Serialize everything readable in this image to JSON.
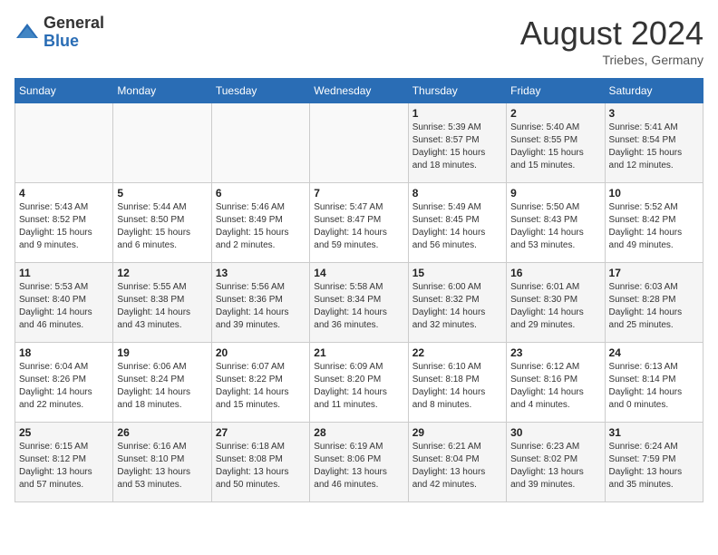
{
  "header": {
    "logo_general": "General",
    "logo_blue": "Blue",
    "month_title": "August 2024",
    "location": "Triebes, Germany"
  },
  "weekdays": [
    "Sunday",
    "Monday",
    "Tuesday",
    "Wednesday",
    "Thursday",
    "Friday",
    "Saturday"
  ],
  "weeks": [
    [
      {
        "day": "",
        "info": ""
      },
      {
        "day": "",
        "info": ""
      },
      {
        "day": "",
        "info": ""
      },
      {
        "day": "",
        "info": ""
      },
      {
        "day": "1",
        "info": "Sunrise: 5:39 AM\nSunset: 8:57 PM\nDaylight: 15 hours\nand 18 minutes."
      },
      {
        "day": "2",
        "info": "Sunrise: 5:40 AM\nSunset: 8:55 PM\nDaylight: 15 hours\nand 15 minutes."
      },
      {
        "day": "3",
        "info": "Sunrise: 5:41 AM\nSunset: 8:54 PM\nDaylight: 15 hours\nand 12 minutes."
      }
    ],
    [
      {
        "day": "4",
        "info": "Sunrise: 5:43 AM\nSunset: 8:52 PM\nDaylight: 15 hours\nand 9 minutes."
      },
      {
        "day": "5",
        "info": "Sunrise: 5:44 AM\nSunset: 8:50 PM\nDaylight: 15 hours\nand 6 minutes."
      },
      {
        "day": "6",
        "info": "Sunrise: 5:46 AM\nSunset: 8:49 PM\nDaylight: 15 hours\nand 2 minutes."
      },
      {
        "day": "7",
        "info": "Sunrise: 5:47 AM\nSunset: 8:47 PM\nDaylight: 14 hours\nand 59 minutes."
      },
      {
        "day": "8",
        "info": "Sunrise: 5:49 AM\nSunset: 8:45 PM\nDaylight: 14 hours\nand 56 minutes."
      },
      {
        "day": "9",
        "info": "Sunrise: 5:50 AM\nSunset: 8:43 PM\nDaylight: 14 hours\nand 53 minutes."
      },
      {
        "day": "10",
        "info": "Sunrise: 5:52 AM\nSunset: 8:42 PM\nDaylight: 14 hours\nand 49 minutes."
      }
    ],
    [
      {
        "day": "11",
        "info": "Sunrise: 5:53 AM\nSunset: 8:40 PM\nDaylight: 14 hours\nand 46 minutes."
      },
      {
        "day": "12",
        "info": "Sunrise: 5:55 AM\nSunset: 8:38 PM\nDaylight: 14 hours\nand 43 minutes."
      },
      {
        "day": "13",
        "info": "Sunrise: 5:56 AM\nSunset: 8:36 PM\nDaylight: 14 hours\nand 39 minutes."
      },
      {
        "day": "14",
        "info": "Sunrise: 5:58 AM\nSunset: 8:34 PM\nDaylight: 14 hours\nand 36 minutes."
      },
      {
        "day": "15",
        "info": "Sunrise: 6:00 AM\nSunset: 8:32 PM\nDaylight: 14 hours\nand 32 minutes."
      },
      {
        "day": "16",
        "info": "Sunrise: 6:01 AM\nSunset: 8:30 PM\nDaylight: 14 hours\nand 29 minutes."
      },
      {
        "day": "17",
        "info": "Sunrise: 6:03 AM\nSunset: 8:28 PM\nDaylight: 14 hours\nand 25 minutes."
      }
    ],
    [
      {
        "day": "18",
        "info": "Sunrise: 6:04 AM\nSunset: 8:26 PM\nDaylight: 14 hours\nand 22 minutes."
      },
      {
        "day": "19",
        "info": "Sunrise: 6:06 AM\nSunset: 8:24 PM\nDaylight: 14 hours\nand 18 minutes."
      },
      {
        "day": "20",
        "info": "Sunrise: 6:07 AM\nSunset: 8:22 PM\nDaylight: 14 hours\nand 15 minutes."
      },
      {
        "day": "21",
        "info": "Sunrise: 6:09 AM\nSunset: 8:20 PM\nDaylight: 14 hours\nand 11 minutes."
      },
      {
        "day": "22",
        "info": "Sunrise: 6:10 AM\nSunset: 8:18 PM\nDaylight: 14 hours\nand 8 minutes."
      },
      {
        "day": "23",
        "info": "Sunrise: 6:12 AM\nSunset: 8:16 PM\nDaylight: 14 hours\nand 4 minutes."
      },
      {
        "day": "24",
        "info": "Sunrise: 6:13 AM\nSunset: 8:14 PM\nDaylight: 14 hours\nand 0 minutes."
      }
    ],
    [
      {
        "day": "25",
        "info": "Sunrise: 6:15 AM\nSunset: 8:12 PM\nDaylight: 13 hours\nand 57 minutes."
      },
      {
        "day": "26",
        "info": "Sunrise: 6:16 AM\nSunset: 8:10 PM\nDaylight: 13 hours\nand 53 minutes."
      },
      {
        "day": "27",
        "info": "Sunrise: 6:18 AM\nSunset: 8:08 PM\nDaylight: 13 hours\nand 50 minutes."
      },
      {
        "day": "28",
        "info": "Sunrise: 6:19 AM\nSunset: 8:06 PM\nDaylight: 13 hours\nand 46 minutes."
      },
      {
        "day": "29",
        "info": "Sunrise: 6:21 AM\nSunset: 8:04 PM\nDaylight: 13 hours\nand 42 minutes."
      },
      {
        "day": "30",
        "info": "Sunrise: 6:23 AM\nSunset: 8:02 PM\nDaylight: 13 hours\nand 39 minutes."
      },
      {
        "day": "31",
        "info": "Sunrise: 6:24 AM\nSunset: 7:59 PM\nDaylight: 13 hours\nand 35 minutes."
      }
    ]
  ]
}
